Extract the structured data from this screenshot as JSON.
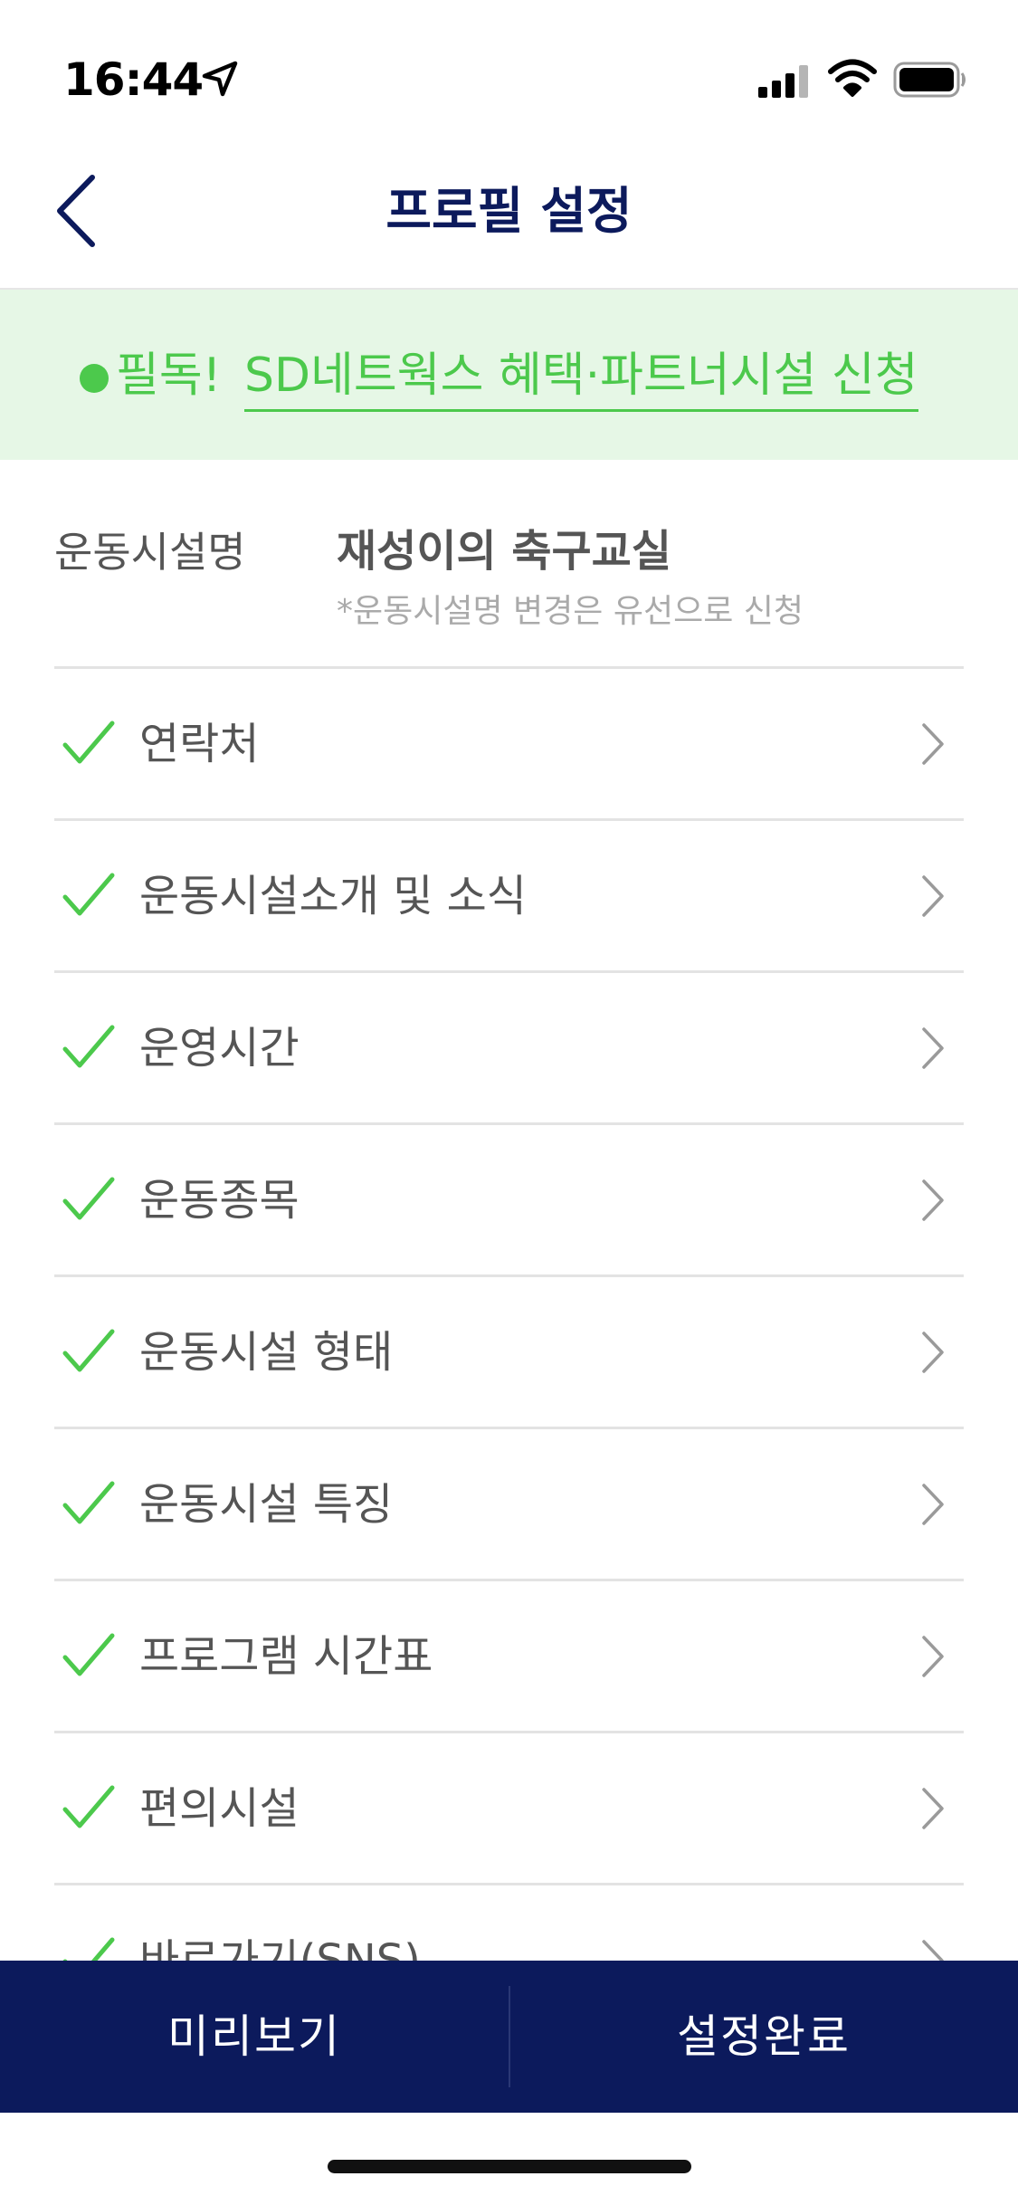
{
  "status_bar": {
    "time": "16:44",
    "icons": [
      "location-arrow-icon",
      "cellular-signal-icon",
      "wifi-icon",
      "battery-icon"
    ]
  },
  "header": {
    "title": "프로필 설정",
    "back_icon": "chevron-left-icon"
  },
  "banner": {
    "prefix": "필독!",
    "link_text": "SD네트웍스 혜택·파트너시설 신청",
    "color": "#4cc94c",
    "background": "#e6f7e6"
  },
  "facility": {
    "label": "운동시설명",
    "value": "재성이의 축구교실",
    "note": "*운동시설명 변경은 유선으로 신청"
  },
  "settings": {
    "items": [
      {
        "label": "연락처",
        "checked": true
      },
      {
        "label": "운동시설소개 및 소식",
        "checked": true
      },
      {
        "label": "운영시간",
        "checked": true
      },
      {
        "label": "운동종목",
        "checked": true
      },
      {
        "label": "운동시설 형태",
        "checked": true
      },
      {
        "label": "운동시설 특징",
        "checked": true
      },
      {
        "label": "프로그램 시간표",
        "checked": true
      },
      {
        "label": "편의시설",
        "checked": true
      },
      {
        "label": "바로가기(SNS)",
        "checked": true
      }
    ]
  },
  "bottom_bar": {
    "preview_label": "미리보기",
    "done_label": "설정완료",
    "background": "#0c1a5c"
  },
  "colors": {
    "accent_navy": "#0c1a5c",
    "check_green": "#4cc94c",
    "divider": "#e3e3e3"
  }
}
